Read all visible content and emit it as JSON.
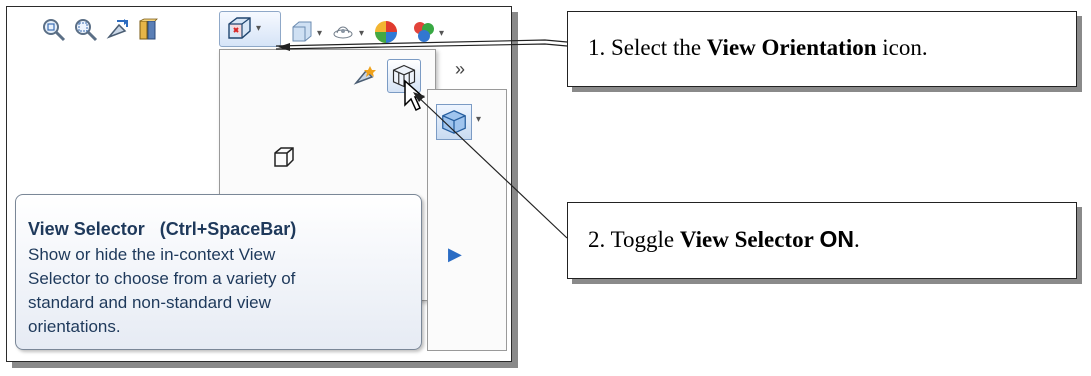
{
  "toolbar": {
    "icons": [
      "zoom-to-fit-icon",
      "zoom-to-area-icon",
      "previous-view-icon",
      "section-view-icon",
      "view-orientation-icon",
      "display-style-icon",
      "hide-show-items-icon",
      "edit-appearance-icon",
      "apply-scene-icon"
    ]
  },
  "tooltip": {
    "title": "View Selector",
    "shortcut": "(Ctrl+SpaceBar)",
    "body_lines": [
      "Show or hide the in-context View",
      "Selector to choose from a variety of",
      "standard and non-standard view",
      "orientations."
    ]
  },
  "callouts": {
    "c1": {
      "prefix": "1. Select the ",
      "bold": "View Orientation",
      "suffix": " icon."
    },
    "c2": {
      "prefix": "2.  Toggle ",
      "bold": "View Selector",
      "bold2": "ON",
      "suffix": "."
    }
  },
  "colors": {
    "tooltip_text": "#1e395b",
    "tooltip_bg_start": "#ffffff",
    "tooltip_bg_end": "#e6ebf4",
    "callout_shadow": "#8a8a8a"
  }
}
